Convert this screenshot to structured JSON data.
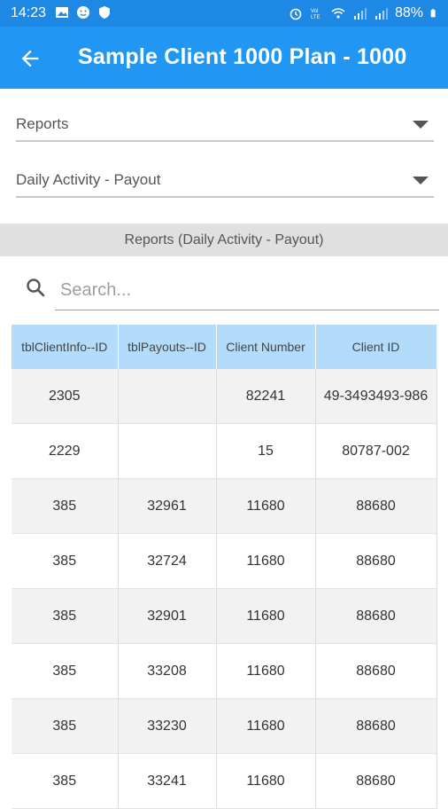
{
  "status": {
    "time": "14:23",
    "battery": "88%",
    "left_icons": [
      "image-icon",
      "smiley-icon",
      "shield-icon"
    ],
    "right_icons": [
      "alarm-icon",
      "volte-icon",
      "wifi-icon",
      "signal-icon",
      "signal2-icon"
    ]
  },
  "appbar": {
    "title": "Sample Client 1000 Plan - 1000"
  },
  "dropdowns": {
    "reports": "Reports",
    "report_type": "Daily Activity - Payout"
  },
  "section": {
    "title": "Reports (Daily Activity - Payout)"
  },
  "search": {
    "placeholder": "Search..."
  },
  "table": {
    "headers": [
      "tblClientInfo--ID",
      "tblPayouts--ID",
      "Client Number",
      "Client ID"
    ],
    "rows": [
      [
        "2305",
        "",
        "82241",
        "49-3493493-986"
      ],
      [
        "2229",
        "",
        "15",
        "80787-002"
      ],
      [
        "385",
        "32961",
        "11680",
        "88680"
      ],
      [
        "385",
        "32724",
        "11680",
        "88680"
      ],
      [
        "385",
        "32901",
        "11680",
        "88680"
      ],
      [
        "385",
        "33208",
        "11680",
        "88680"
      ],
      [
        "385",
        "33230",
        "11680",
        "88680"
      ],
      [
        "385",
        "33241",
        "11680",
        "88680"
      ]
    ]
  },
  "colors": {
    "status_bar": "#1e88e5",
    "app_bar": "#2196f3",
    "table_header": "#b3dcfb",
    "section_bar": "#e0e0e0"
  }
}
